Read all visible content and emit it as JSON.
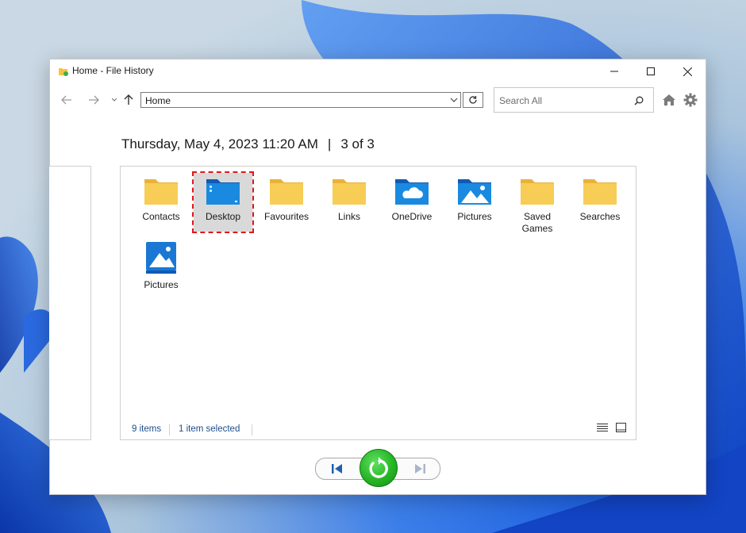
{
  "window": {
    "title": "Home - File History"
  },
  "toolbar": {
    "address": "Home",
    "search_placeholder": "Search All"
  },
  "header": {
    "date": "Thursday, May 4, 2023 11:20 AM",
    "separator": "|",
    "position": "3 of 3"
  },
  "items": [
    {
      "label": "Contacts",
      "icon": "folder-icon"
    },
    {
      "label": "Desktop",
      "icon": "desktop-folder-icon",
      "selected": true
    },
    {
      "label": "Favourites",
      "icon": "folder-icon"
    },
    {
      "label": "Links",
      "icon": "folder-icon"
    },
    {
      "label": "OneDrive",
      "icon": "onedrive-folder-icon"
    },
    {
      "label": "Pictures",
      "icon": "pictures-folder-icon"
    },
    {
      "label": "Saved Games",
      "icon": "folder-icon"
    },
    {
      "label": "Searches",
      "icon": "folder-icon"
    },
    {
      "label": "Pictures",
      "icon": "pictures-library-icon"
    }
  ],
  "status": {
    "count": "9 items",
    "selected": "1 item selected"
  },
  "colors": {
    "folder_yellow": "#f5c542",
    "folder_blue": "#1a78d4",
    "selection_outline": "#e0171d",
    "restore_green": "#26b526"
  }
}
